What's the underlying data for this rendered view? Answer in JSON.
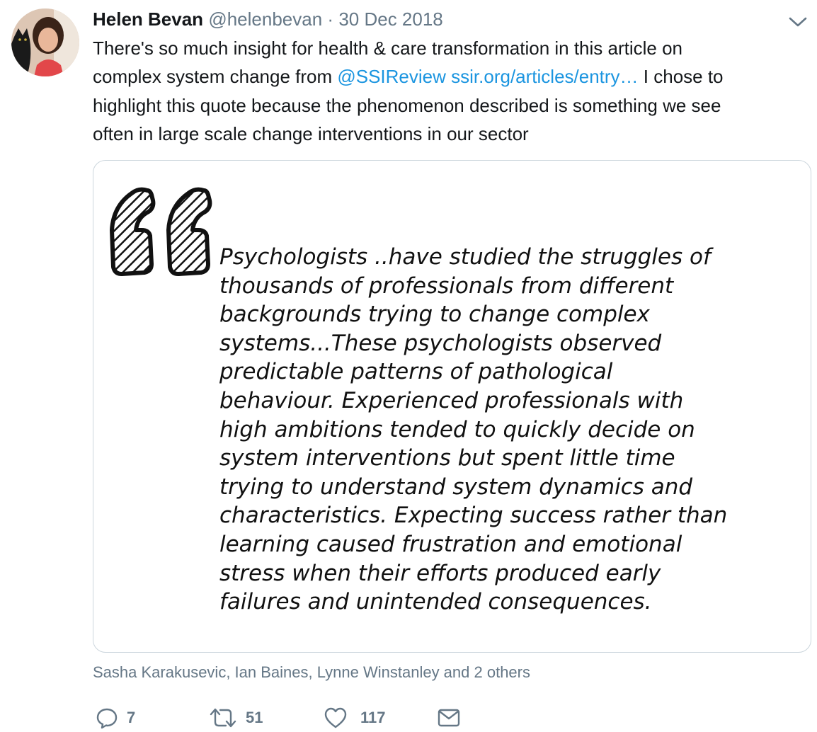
{
  "tweet": {
    "author_name": "Helen Bevan",
    "handle": "@helenbevan",
    "separator": "·",
    "date": "30 Dec 2018",
    "text_lines": [
      [
        {
          "t": "There's so much insight for health & care transformation in this article on",
          "link": false
        }
      ],
      [
        {
          "t": "complex system change from ",
          "link": false
        },
        {
          "t": "@SSIReview",
          "link": true
        },
        {
          "t": " ",
          "link": false
        },
        {
          "t": "ssir.org/articles/entry…",
          "link": true
        },
        {
          "t": " I chose to",
          "link": false
        }
      ],
      [
        {
          "t": "highlight this quote because the phenomenon described is something we see",
          "link": false
        }
      ],
      [
        {
          "t": "often in large scale change interventions in our sector",
          "link": false
        }
      ]
    ]
  },
  "image_card": {
    "quote_lines": [
      "Psychologists ..have studied the struggles of",
      "thousands of professionals from different",
      "backgrounds trying to change complex",
      "systems...These psychologists observed",
      "predictable patterns of pathological",
      "behaviour. Experienced professionals with",
      "high ambitions tended to quickly decide on",
      "system interventions but spent little time",
      "trying to understand system dynamics and",
      "characteristics. Expecting success rather than",
      "learning caused frustration and emotional",
      "stress when their efforts produced early",
      "failures and unintended consequences."
    ]
  },
  "tagged_people": "Sasha Karakusevic, Ian Baines, Lynne Winstanley and 2 others",
  "actions": {
    "reply_count": "7",
    "retweet_count": "51",
    "like_count": "117"
  },
  "colors": {
    "link": "#1b95e0",
    "secondary_text": "#657786",
    "border": "#ccd6dd"
  },
  "icons": [
    "caret-down-icon",
    "reply-icon",
    "retweet-icon",
    "like-icon",
    "direct-message-icon",
    "quote-marks-icon"
  ]
}
